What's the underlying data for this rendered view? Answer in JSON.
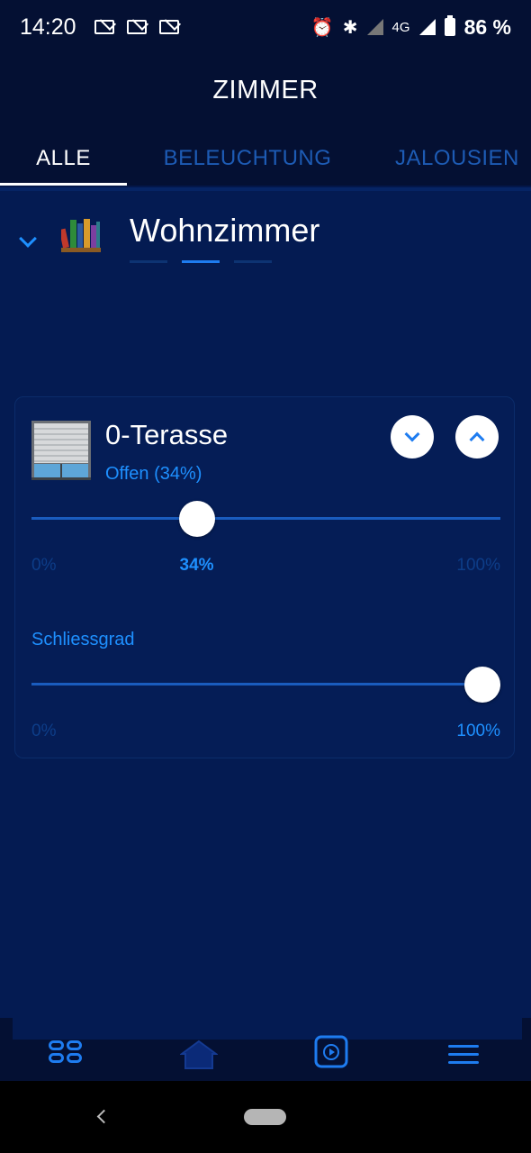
{
  "status_bar": {
    "time": "14:20",
    "notifications": [
      "mail-icon",
      "mail-icon",
      "mail-icon"
    ],
    "network": "4G",
    "battery": "86 %"
  },
  "header": {
    "title": "ZIMMER"
  },
  "tabs": [
    {
      "label": "ALLE",
      "active": true
    },
    {
      "label": "BELEUCHTUNG",
      "active": false
    },
    {
      "label": "JALOUSIEN",
      "active": false
    }
  ],
  "room": {
    "name": "Wohnzimmer",
    "page_count": 3,
    "active_page": 2,
    "icon": "books-icon"
  },
  "device": {
    "name": "0-Terasse",
    "status": "Offen (34%)",
    "icon": "shutter-icon",
    "position_slider": {
      "min_label": "0%",
      "max_label": "100%",
      "value_label": "34%",
      "value": 34
    },
    "closing_section_label": "Schliessgrad",
    "closing_slider": {
      "min_label": "0%",
      "max_label": "100%",
      "value": 100
    }
  },
  "bottom_nav": [
    "grid-icon",
    "home-icon",
    "play-icon",
    "menu-icon"
  ],
  "colors": {
    "accent": "#1e90ff",
    "background": "#041b52",
    "bar": "#041033"
  }
}
